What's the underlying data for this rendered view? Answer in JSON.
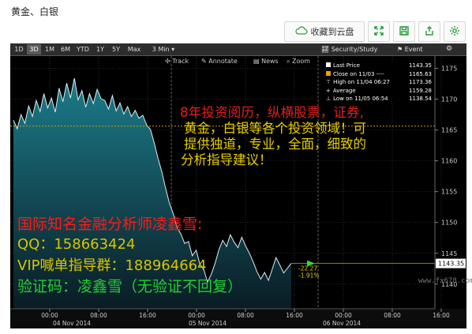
{
  "page_title": "黄金、白银",
  "toolbar": {
    "save_to_cloud": "收藏到云盘",
    "icons": [
      "cloud-icon",
      "expand-icon",
      "save-icon",
      "share-icon",
      "gear-icon"
    ]
  },
  "terminal": {
    "ranges": [
      "1D",
      "3D",
      "1M",
      "6M",
      "YTD",
      "1Y",
      "5Y",
      "Max",
      "3 Min"
    ],
    "selected_range": "3D",
    "subbar": {
      "track": "Track",
      "annotate": "Annotate",
      "news": "News",
      "zoom": "Zoom",
      "security": "Security/Study",
      "event": "Event"
    },
    "legend": {
      "last_price_label": "Last Price",
      "last_price": "1143.35",
      "close_label": "Close on 11/03 ----",
      "close": "1165.63",
      "high_label": "High on 11/04 06:27",
      "high": "1173.36",
      "average_label": "Average",
      "average": "1159.28",
      "low_label": "Low on 11/05 06:54",
      "low": "1138.54"
    },
    "price_tag": "1143.35",
    "change_abs": "-22.27",
    "change_pct": "-1.91%",
    "colors": {
      "up_tag": "#3ad43a",
      "area_top": "#1c7c8a",
      "close_line": "#d0a000"
    }
  },
  "chart_data": {
    "type": "area",
    "title": "",
    "xlabel": "",
    "ylabel": "",
    "ylim": [
      1136,
      1177
    ],
    "yticks": [
      1140,
      1145,
      1150,
      1155,
      1160,
      1165,
      1170,
      1175
    ],
    "x_ticks": [
      "00:00",
      "08:00",
      "16:00",
      "00:00",
      "08:00",
      "16:00",
      "00:00",
      "08:00",
      "16:00"
    ],
    "date_labels": [
      "04 Nov 2014",
      "05 Nov 2014",
      "06 Nov 2014"
    ],
    "close_level": 1165.63,
    "last_price": 1143.35,
    "series": [
      {
        "values": [
          1166.6,
          1165.2,
          1167.5,
          1166.1,
          1168.9,
          1167.2,
          1169.8,
          1168.0,
          1170.9,
          1168.6,
          1170.2,
          1167.9,
          1171.8,
          1169.6,
          1172.6,
          1170.2,
          1173.4,
          1169.9,
          1171.4,
          1168.7,
          1170.9,
          1169.3,
          1171.6,
          1170.1,
          1169.8,
          1168.4,
          1170.6,
          1168.1,
          1169.4,
          1167.6,
          1168.8,
          1167.2,
          1168.2,
          1166.9,
          1167.4,
          1165.8,
          1165.1,
          1162.9,
          1160.4,
          1158.2,
          1155.5,
          1153.1,
          1151.4,
          1149.2,
          1148.1,
          1146.6,
          1146.9,
          1144.6,
          1145.5,
          1143.2,
          1142.4,
          1140.3,
          1141.6,
          1143.4,
          1145.6,
          1147.1,
          1146.1,
          1148.0,
          1146.8,
          1145.9,
          1147.6,
          1146.2,
          1145.0,
          1143.6,
          1142.0,
          1140.8,
          1141.9,
          1140.6,
          1142.4,
          1144.3,
          1143.1,
          1141.8,
          1142.6,
          1143.35
        ]
      }
    ]
  },
  "overlay_text": {
    "line1": "8年投资阅历，纵横股票，证券,",
    "line2": "黄金，白银等各个投资领域！可",
    "line3": "提供独道，专业，全面，细致的",
    "line4": "分析指导建议！",
    "analyst": "国际知名金融分析师凌鑫雪:",
    "qq": "QQ：158663424",
    "vip": "VIP喊单指导群：188964664",
    "verify": "验证码：凌鑫雪（无验证不回复）"
  },
  "watermark": "www.fx678.com"
}
